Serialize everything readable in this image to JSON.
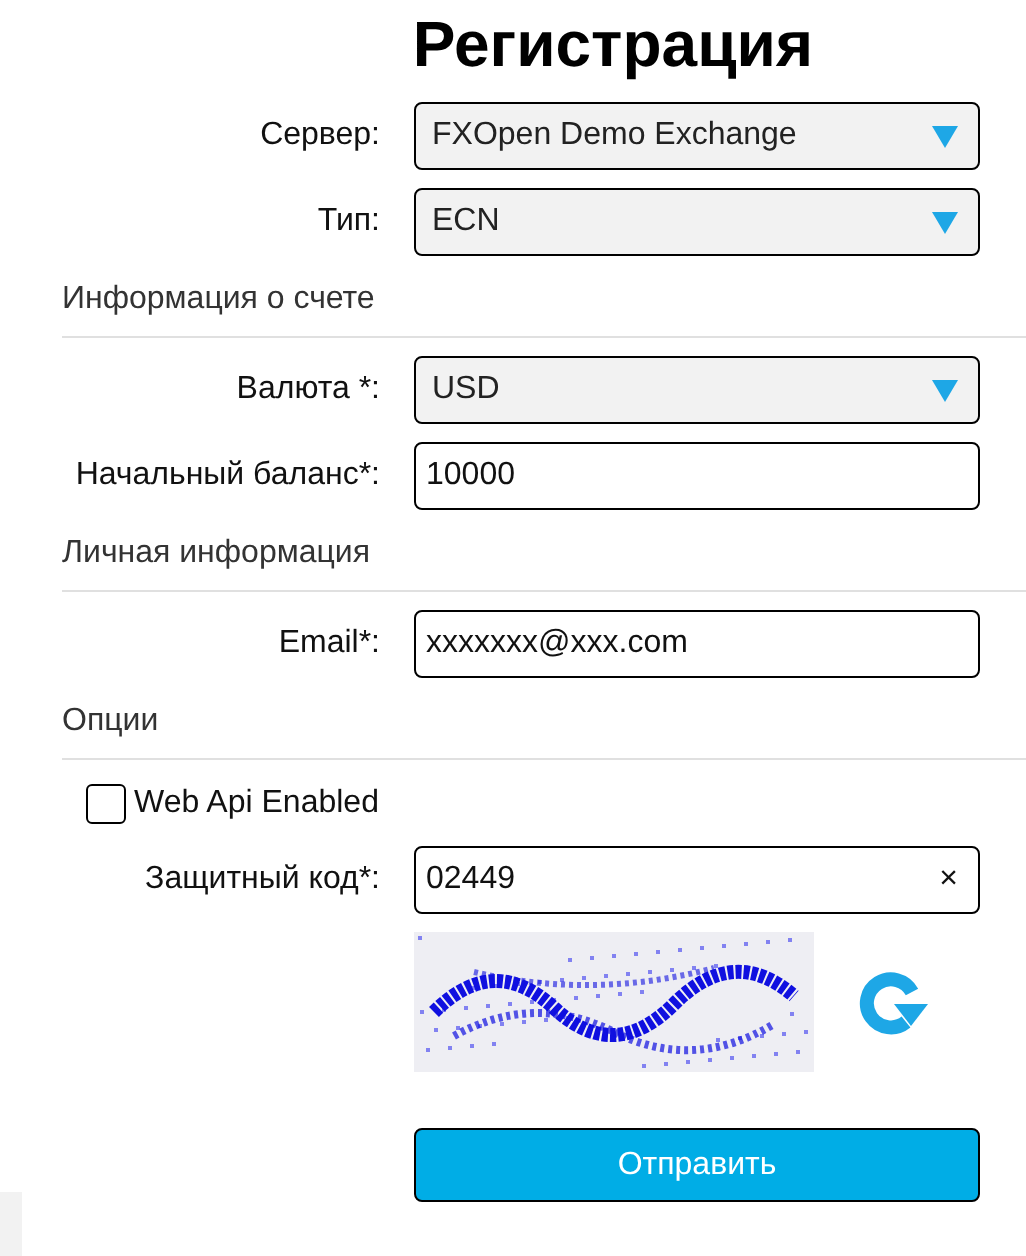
{
  "title": "Регистрация",
  "sections": [
    {
      "fields": [
        {
          "kind": "select",
          "label": "Сервер:",
          "value": "FXOpen Demo Exchange"
        },
        {
          "kind": "select",
          "label": "Тип:",
          "value": "ECN"
        }
      ]
    },
    {
      "heading": "Информация о счете",
      "fields": [
        {
          "kind": "select",
          "label": "Валюта *:",
          "value": "USD"
        },
        {
          "kind": "text",
          "label": "Начальный баланс*:",
          "value": "10000"
        }
      ]
    },
    {
      "heading": "Личная информация",
      "fields": [
        {
          "kind": "text",
          "label": "Email*:",
          "value": "xxxxxxx@xxx.com"
        }
      ]
    },
    {
      "heading": "Опции",
      "fields": [
        {
          "kind": "checkbox",
          "label": "Web Api Enabled",
          "checked": false
        },
        {
          "kind": "clearable",
          "label": "Защитный код*:",
          "value": "02449",
          "clear": "×"
        },
        {
          "kind": "captcha"
        }
      ]
    }
  ],
  "submit": "Отправить"
}
